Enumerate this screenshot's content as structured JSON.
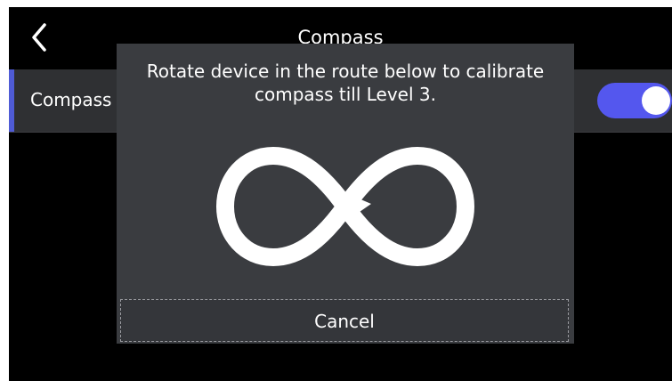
{
  "header": {
    "title": "Compass",
    "back_icon": "chevron-left-icon"
  },
  "settings": {
    "compass_label": "Compass",
    "compass_enabled": true
  },
  "dialog": {
    "message_line1": "Rotate device in the route below to calibrate",
    "message_line2": "compass till Level 3.",
    "figure_icon": "infinity-route-icon",
    "cancel_label": "Cancel"
  },
  "colors": {
    "toggle_on": "#5457ee",
    "row_accent": "#4f5bd5",
    "dialog_bg": "#3a3c40"
  }
}
